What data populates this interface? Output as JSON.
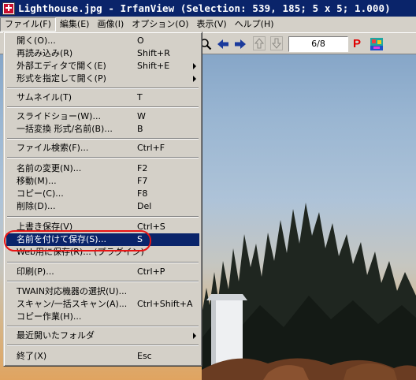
{
  "window": {
    "title": "Lighthouse.jpg - IrfanView (Selection: 539, 185; 5 x 5; 1.000)"
  },
  "menubar": {
    "items": [
      {
        "label": "ファイル(F)"
      },
      {
        "label": "編集(E)"
      },
      {
        "label": "画像(I)"
      },
      {
        "label": "オプション(O)"
      },
      {
        "label": "表示(V)"
      },
      {
        "label": "ヘルプ(H)"
      }
    ]
  },
  "toolbar": {
    "page_value": "6/8",
    "icons": [
      "zoom-icon",
      "arrow-left-icon",
      "arrow-right-icon",
      "arrow-up-icon",
      "arrow-down-icon",
      "properties-icon",
      "paint-icon"
    ],
    "p_label": "P"
  },
  "file_menu": {
    "groups": [
      [
        {
          "label": "開く(O)...",
          "shortcut": "O"
        },
        {
          "label": "再読み込み(R)",
          "shortcut": "Shift+R"
        },
        {
          "label": "外部エディタで開く(E)",
          "shortcut": "Shift+E",
          "submenu": true
        },
        {
          "label": "形式を指定して開く(P)",
          "shortcut": "",
          "submenu": true
        }
      ],
      [
        {
          "label": "サムネイル(T)",
          "shortcut": "T"
        }
      ],
      [
        {
          "label": "スライドショー(W)...",
          "shortcut": "W"
        },
        {
          "label": "一括変換 形式/名前(B)...",
          "shortcut": "B"
        }
      ],
      [
        {
          "label": "ファイル検索(F)...",
          "shortcut": "Ctrl+F"
        }
      ],
      [
        {
          "label": "名前の変更(N)...",
          "shortcut": "F2"
        },
        {
          "label": "移動(M)...",
          "shortcut": "F7"
        },
        {
          "label": "コピー(C)...",
          "shortcut": "F8"
        },
        {
          "label": "削除(D)...",
          "shortcut": "Del"
        }
      ],
      [
        {
          "label": "上書き保存(V)",
          "shortcut": "Ctrl+S"
        },
        {
          "label": "名前を付けて保存(S)...",
          "shortcut": "S",
          "highlighted": true
        },
        {
          "label": "Web用に保存(R)... (プラグイン)",
          "shortcut": ""
        }
      ],
      [
        {
          "label": "印刷(P)...",
          "shortcut": "Ctrl+P"
        }
      ],
      [
        {
          "label": "TWAIN対応機器の選択(U)...",
          "shortcut": ""
        },
        {
          "label": "スキャン/一括スキャン(A)...",
          "shortcut": "Ctrl+Shift+A"
        },
        {
          "label": "コピー作業(H)...",
          "shortcut": ""
        }
      ],
      [
        {
          "label": "最近開いたフォルダ",
          "shortcut": "",
          "submenu": true
        }
      ],
      [
        {
          "label": "終了(X)",
          "shortcut": "Esc"
        }
      ]
    ]
  },
  "colors": {
    "title_bar": "#0a246a",
    "highlight": "#0a246a",
    "annotation": "#e81414"
  }
}
